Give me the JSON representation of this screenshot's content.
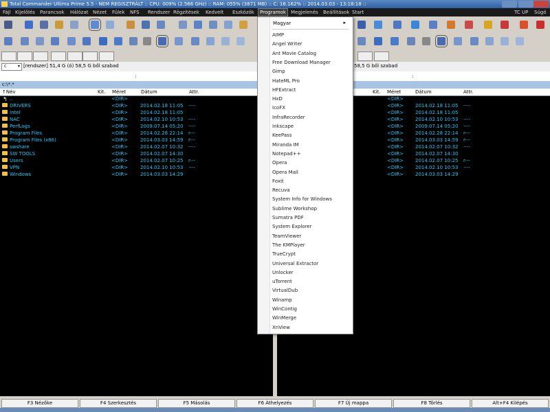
{
  "window": {
    "title": "Total Commander Ultima Prime 5.5 - NEM REGISZTRÁLT :: CPU: 009% (2.566 GHz) :: RAM: 055% (3871 MB) :: C: 16.162% :: 2014.03.03 - 13:18:18 ::"
  },
  "menubar": {
    "items": [
      {
        "label": "Fájl",
        "active": false
      },
      {
        "label": "Kijelölés",
        "active": false
      },
      {
        "label": "Parancsok",
        "active": false
      },
      {
        "label": "Hálózat",
        "active": false
      },
      {
        "label": "Nézet",
        "active": false
      },
      {
        "label": "Fülek",
        "active": false
      },
      {
        "label": "NFS",
        "active": false
      },
      {
        "label": "Rendszer",
        "active": false
      },
      {
        "label": "Rögzítések",
        "active": false
      },
      {
        "label": "Kedvelt",
        "active": false
      },
      {
        "label": "Eszközök",
        "active": false
      },
      {
        "label": "Programok",
        "active": true
      },
      {
        "label": "Megjelenés",
        "active": false
      },
      {
        "label": "Beállítások",
        "active": false
      },
      {
        "label": "Start",
        "active": false
      }
    ],
    "right_items": [
      "TC UP",
      "Súgó"
    ]
  },
  "left_panel": {
    "drive": "c",
    "drive_info": "[rendszer]  51,4 G (ó) 58,5 G ből szabad",
    "path_sep": ":",
    "path": "c:\\*.*",
    "columns": {
      "name": "Név",
      "ext": "Kit.",
      "size": "Méret",
      "date": "Dátum",
      "attr": "Attr."
    },
    "rows": [
      {
        "name": "..",
        "ext": "",
        "size": "<DIR>",
        "date": "",
        "attr": "",
        "up": true
      },
      {
        "name": "DRIVERS",
        "ext": "",
        "size": "<DIR>",
        "date": "2014.02.18 11:05",
        "attr": "----"
      },
      {
        "name": "Intel",
        "ext": "",
        "size": "<DIR>",
        "date": "2014.02.18 11:05",
        "attr": ""
      },
      {
        "name": "NAC",
        "ext": "",
        "size": "<DIR>",
        "date": "2014.02.10 10:53",
        "attr": "----"
      },
      {
        "name": "PerfLogs",
        "ext": "",
        "size": "<DIR>",
        "date": "2009.07.14 05:20",
        "attr": "----"
      },
      {
        "name": "Program Files",
        "ext": "",
        "size": "<DIR>",
        "date": "2014.02.28 22:14",
        "attr": "r---"
      },
      {
        "name": "Program Files (x86)",
        "ext": "",
        "size": "<DIR>",
        "date": "2014.03.03 14:59",
        "attr": "r---"
      },
      {
        "name": "swshare",
        "ext": "",
        "size": "<DIR>",
        "date": "2014.02.07 10:32",
        "attr": "----"
      },
      {
        "name": "SW TOOLS",
        "ext": "",
        "size": "<DIR>",
        "date": "2014.02.07 14:30",
        "attr": ""
      },
      {
        "name": "Users",
        "ext": "",
        "size": "<DIR>",
        "date": "2014.02.07 10:25",
        "attr": "r---"
      },
      {
        "name": "VPN",
        "ext": "",
        "size": "<DIR>",
        "date": "2014.02.10 10:53",
        "attr": "----"
      },
      {
        "name": "Windows",
        "ext": "",
        "size": "<DIR>",
        "date": "2014.03.03 14:29",
        "attr": ""
      }
    ]
  },
  "right_panel": {
    "drive_info": "58,5 G ből szabad",
    "path_sep": ":",
    "columns": {
      "ext": "Kit.",
      "size": "Méret",
      "date": "Dátum",
      "attr": "Attr."
    },
    "rows": [
      {
        "size": "<DIR>",
        "date": "",
        "attr": ""
      },
      {
        "size": "<DIR>",
        "date": "2014.02.18 11:05",
        "attr": "----"
      },
      {
        "size": "<DIR>",
        "date": "2014.02.18 11:05",
        "attr": ""
      },
      {
        "size": "<DIR>",
        "date": "2014.02.10 10:53",
        "attr": "----"
      },
      {
        "size": "<DIR>",
        "date": "2009.07.14 05:20",
        "attr": "----"
      },
      {
        "size": "<DIR>",
        "date": "2014.02.28 22:14",
        "attr": "r---"
      },
      {
        "size": "<DIR>",
        "date": "2014.03.03 14:59",
        "attr": "r---"
      },
      {
        "size": "<DIR>",
        "date": "2014.02.07 10:32",
        "attr": "----"
      },
      {
        "size": "<DIR>",
        "date": "2014.02.07 14:30",
        "attr": ""
      },
      {
        "size": "<DIR>",
        "date": "2014.02.07 10:25",
        "attr": "r---"
      },
      {
        "size": "<DIR>",
        "date": "2014.02.10 10:53",
        "attr": "----"
      },
      {
        "size": "<DIR>",
        "date": "2014.03.03 14:29",
        "attr": ""
      }
    ]
  },
  "programs_menu": {
    "header": "Magyar",
    "items": [
      "AIMP",
      "Angel Writer",
      "Ant Movie Catalog",
      "Free Download Manager",
      "Gimp",
      "HateML Pro",
      "HFExtract",
      "HxD",
      "IcoFX",
      "InfraRecorder",
      "Inkscape",
      "KeePass",
      "Miranda IM",
      "Notepad++",
      "Opera",
      "Opera Mail",
      "Foxit",
      "Recuva",
      "System Info for Windows",
      "Sublime Workshop",
      "Sumatra PDF",
      "System Explorer",
      "TeamViewer",
      "The KMPlayer",
      "TrueCrypt",
      "Universal Extractor",
      "Unlocker",
      "uTorrent",
      "VirtualDub",
      "Winamp",
      "WinContig",
      "WinMerge",
      "XnView"
    ]
  },
  "function_keys": [
    "F3 Nézőke",
    "F4 Szerkesztés",
    "F5 Másolás",
    "F6 Áthelyezés",
    "F7 Új mappa",
    "F8 Törlés",
    "Alt+F4 Kilépés"
  ],
  "colors": {
    "file_text": "#1ec8f5",
    "panel_bg": "#000000",
    "menubar_bg": "#1a1a1a",
    "pathbar_bg": "#a8c4e4",
    "chrome_bg": "#d4d0c8"
  }
}
